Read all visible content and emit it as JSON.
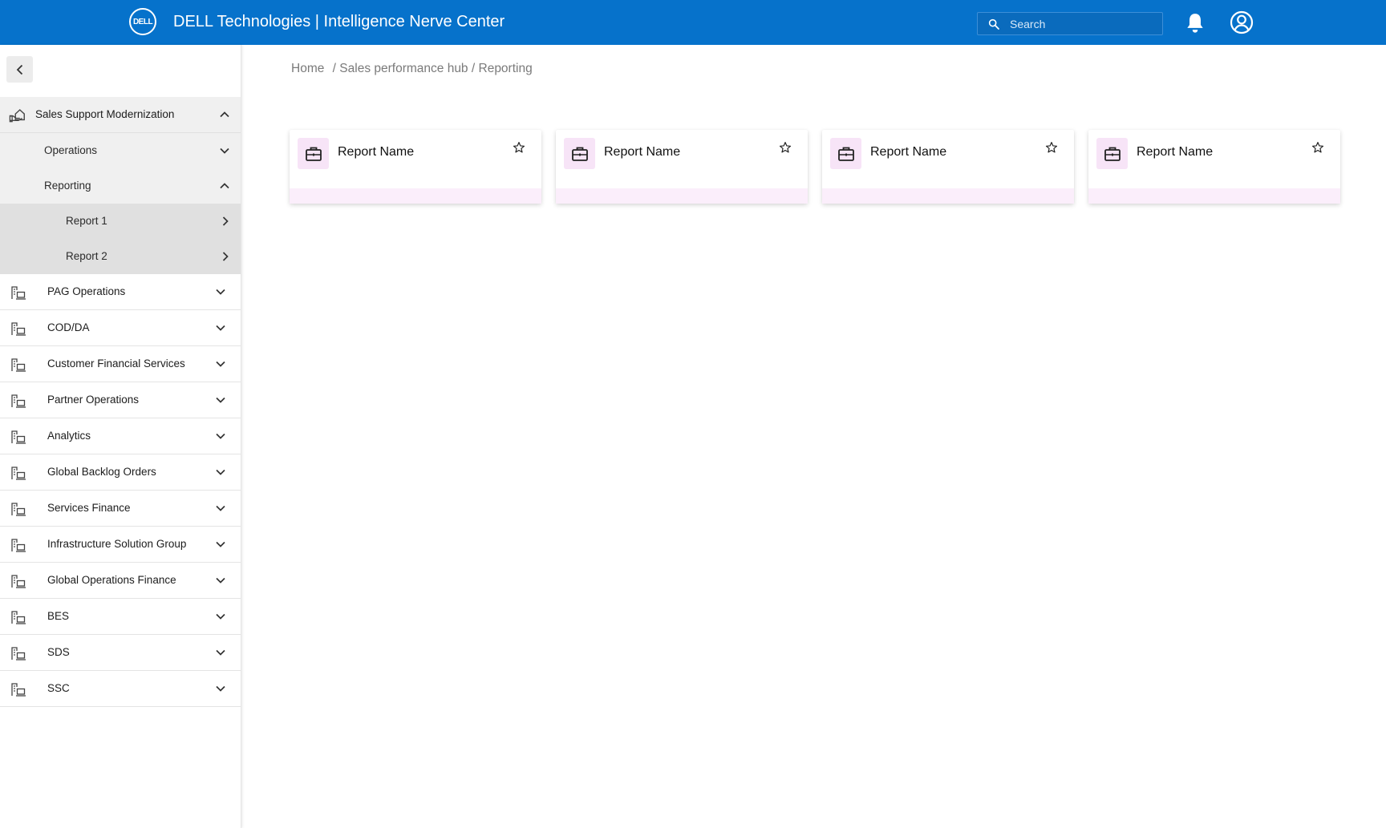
{
  "header": {
    "logo_text": "DELL",
    "title": "DELL Technologies | Intelligence Nerve Center",
    "search_placeholder": "Search"
  },
  "sidebar": {
    "group": {
      "label": "Sales Support Modernization",
      "expanded": true,
      "children": [
        {
          "label": "Operations",
          "expanded": false
        },
        {
          "label": "Reporting",
          "expanded": true,
          "children": [
            {
              "label": "Report 1"
            },
            {
              "label": "Report 2"
            }
          ]
        }
      ]
    },
    "items": [
      {
        "label": "PAG Operations"
      },
      {
        "label": "COD/DA"
      },
      {
        "label": "Customer Financial Services"
      },
      {
        "label": "Partner Operations"
      },
      {
        "label": "Analytics"
      },
      {
        "label": "Global Backlog Orders"
      },
      {
        "label": "Services Finance"
      },
      {
        "label": "Infrastructure Solution Group"
      },
      {
        "label": "Global Operations Finance"
      },
      {
        "label": "BES"
      },
      {
        "label": "SDS"
      },
      {
        "label": "SSC"
      }
    ]
  },
  "breadcrumb": {
    "home": "Home",
    "sep1": "/",
    "hub": "Sales performance hub",
    "sep2": "/",
    "current": "Reporting"
  },
  "cards": [
    {
      "title": "Report Name"
    },
    {
      "title": "Report Name"
    },
    {
      "title": "Report Name"
    },
    {
      "title": "Report Name"
    }
  ],
  "colors": {
    "brand": "#0672cb",
    "card_accent": "#fbeefb",
    "card_icon_bg": "#f7e4f7"
  }
}
